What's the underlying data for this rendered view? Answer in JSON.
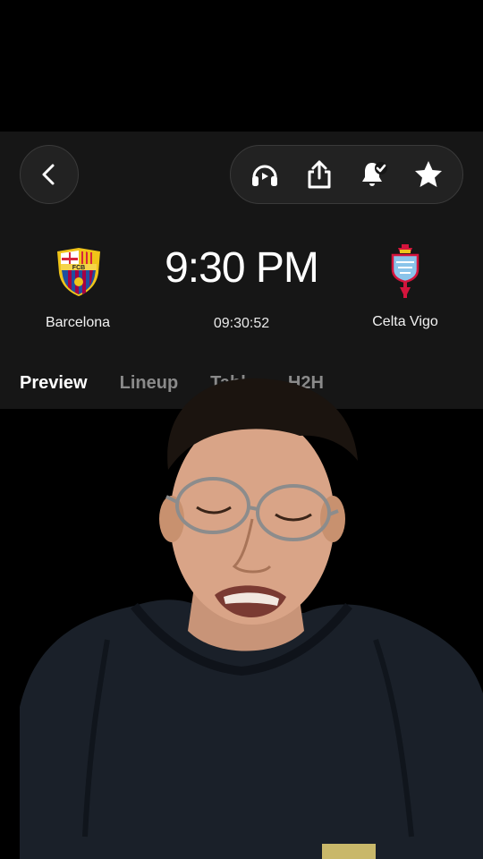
{
  "actions": {
    "back": "back",
    "icons": [
      "headphones-icon",
      "share-icon",
      "bell-check-icon",
      "star-icon"
    ]
  },
  "match": {
    "home": {
      "name": "Barcelona",
      "crest_text": "FCB"
    },
    "away": {
      "name": "Celta Vigo"
    },
    "kickoff": "9:30 PM",
    "countdown": "09:30:52"
  },
  "tabs": [
    {
      "label": "Preview",
      "active": true
    },
    {
      "label": "Lineup",
      "active": false
    },
    {
      "label": "Table",
      "active": false
    },
    {
      "label": "H2H",
      "active": false
    }
  ],
  "colors": {
    "panel": "#161616",
    "barca_blue": "#1f4fa0",
    "barca_red": "#a50044",
    "celta_blue": "#8ac4ea",
    "celta_red": "#d4143c"
  }
}
